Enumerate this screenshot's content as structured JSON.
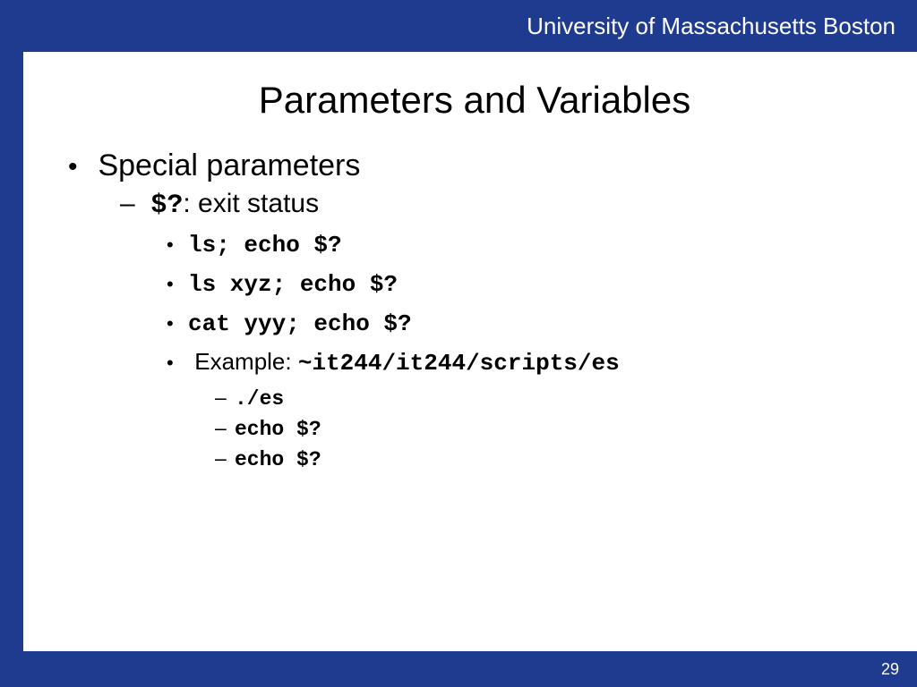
{
  "header": {
    "institution": "University of Massachusetts Boston"
  },
  "slide": {
    "title": "Parameters and Variables",
    "l1_item": "Special parameters",
    "l2_symbol": "$?",
    "l2_desc": ": exit status",
    "l3_cmd1": "ls; echo $?",
    "l3_cmd2": "ls xyz; echo $?",
    "l3_cmd3": "cat yyy; echo $?",
    "l3_example_label": "Example: ",
    "l3_example_path": "~it244/it244/scripts/es",
    "l4_cmd1": "./es",
    "l4_cmd2": "echo $?",
    "l4_cmd3": "echo $?"
  },
  "footer": {
    "page": "29"
  }
}
